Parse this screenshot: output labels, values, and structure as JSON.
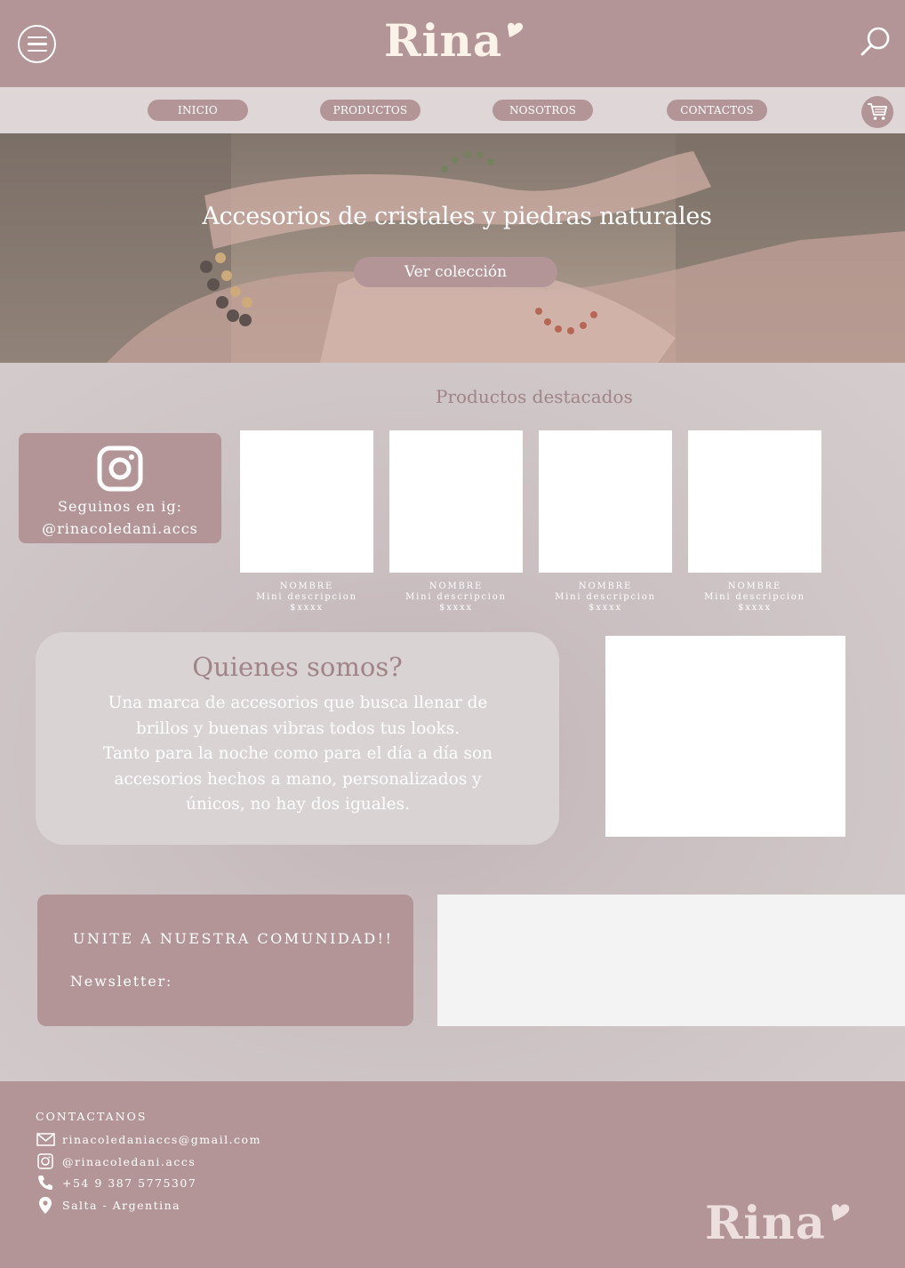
{
  "brand": {
    "name": "Rina"
  },
  "header": {
    "menu_icon": "hamburger-menu-icon",
    "search_icon": "search-icon"
  },
  "nav": {
    "items": [
      {
        "label": "INICIO"
      },
      {
        "label": "PRODUCTOS"
      },
      {
        "label": "NOSOTROS"
      },
      {
        "label": "CONTACTOS"
      }
    ],
    "cart_icon": "cart-icon"
  },
  "hero": {
    "title": "Accesorios de cristales y piedras naturales",
    "button_label": "Ver colección"
  },
  "featured": {
    "title": "Productos destacados",
    "instagram": {
      "line1": "Seguinos en ig:",
      "line2": "@rinacoledani.accs"
    },
    "products": [
      {
        "name": "NOMBRE",
        "description": "Mini descripcion",
        "price": "$xxxx"
      },
      {
        "name": "NOMBRE",
        "description": "Mini descripcion",
        "price": "$xxxx"
      },
      {
        "name": "NOMBRE",
        "description": "Mini descripcion",
        "price": "$xxxx"
      },
      {
        "name": "NOMBRE",
        "description": "Mini descripcion",
        "price": "$xxxx"
      }
    ]
  },
  "about": {
    "title": "Quienes somos?",
    "text_lines": [
      "Una marca de accesorios que busca llenar de",
      "brillos y buenas vibras todos tus looks.",
      "Tanto para la noche como para el día a día son",
      "accesorios hechos a mano, personalizados y",
      "únicos, no hay dos iguales."
    ]
  },
  "newsletter": {
    "title": "UNITE A NUESTRA COMUNIDAD!!",
    "label": "Newsletter:",
    "input_value": ""
  },
  "footer": {
    "title": "CONTACTANOS",
    "email": "rinacoledaniaccs@gmail.com",
    "instagram": "@rinacoledani.accs",
    "phone": "+54 9 387 5775307",
    "location": "Salta - Argentina"
  },
  "colors": {
    "brand": "#b39597",
    "nav_bg": "#dfd7d7",
    "accent_text": "#a08487",
    "logo": "#fbf3ea"
  }
}
